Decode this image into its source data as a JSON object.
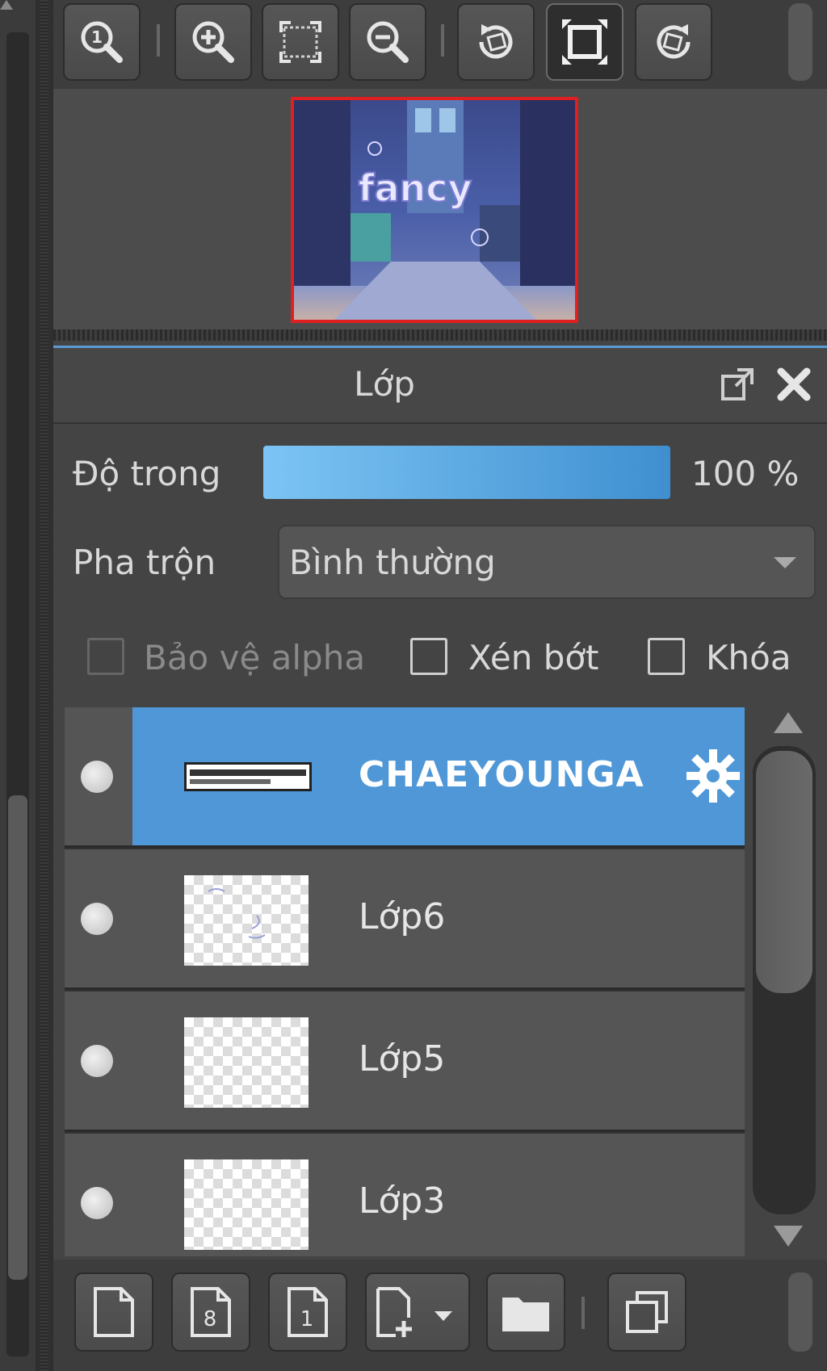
{
  "top_toolbar": {
    "buttons": [
      "zoom-actual-icon",
      "zoom-in-icon",
      "fit-screen-icon",
      "zoom-out-icon",
      "rotate-left-icon",
      "fullscreen-icon",
      "rotate-right-icon"
    ]
  },
  "navigator": {
    "preview_caption": "fancy"
  },
  "layer_panel": {
    "title": "Lớp",
    "opacity_label": "Độ trong",
    "opacity_value": "100 %",
    "opacity_fraction": 1.0,
    "blend_label": "Pha trộn",
    "blend_value": "Bình thường",
    "protect_alpha_label": "Bảo vệ alpha",
    "clip_label": "Xén bớt",
    "lock_label": "Khóa",
    "layers": [
      {
        "name": "CHAEYOUNGA",
        "selected": true,
        "type": "text"
      },
      {
        "name": "Lớp6",
        "selected": false,
        "type": "raster"
      },
      {
        "name": "Lớp5",
        "selected": false,
        "type": "raster"
      },
      {
        "name": "Lớp3",
        "selected": false,
        "type": "raster"
      }
    ]
  },
  "bottom_toolbar": {
    "buttons": [
      "new-layer-icon",
      "new-8bit-layer-icon",
      "new-1bit-layer-icon",
      "add-layer-dropdown-icon",
      "new-folder-icon",
      "duplicate-layer-icon"
    ],
    "layer_8bit_glyph": "8",
    "layer_1bit_glyph": "1"
  },
  "colors": {
    "selection": "#4f97d6",
    "opacity_fill_start": "#7cc4f4",
    "opacity_fill_end": "#3f8fd0",
    "navigator_frame": "#e02020"
  }
}
